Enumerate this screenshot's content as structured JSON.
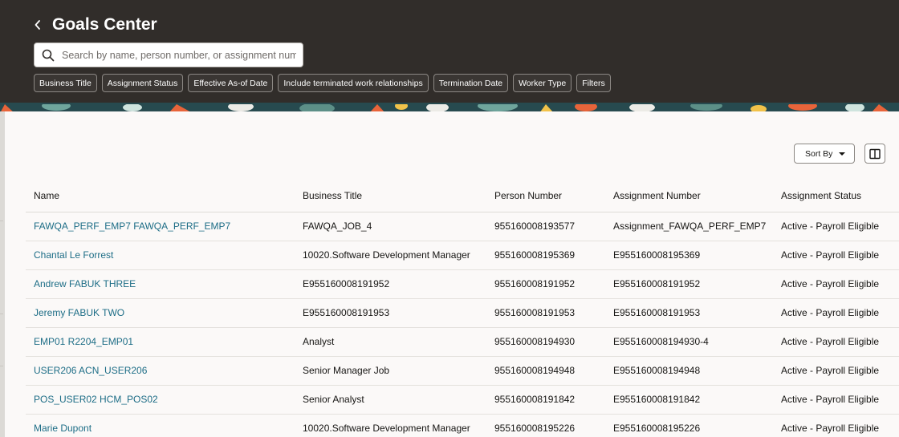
{
  "header": {
    "title": "Goals Center",
    "search": {
      "placeholder": "Search by name, person number, or assignment number",
      "value": ""
    },
    "filter_chips": [
      "Business Title",
      "Assignment Status",
      "Effective As-of Date",
      "Include terminated work relationships",
      "Termination Date",
      "Worker Type",
      "Filters"
    ]
  },
  "toolbar": {
    "sort_label": "Sort By"
  },
  "table": {
    "columns": [
      "Name",
      "Business Title",
      "Person Number",
      "Assignment Number",
      "Assignment Status"
    ],
    "rows": [
      [
        "FAWQA_PERF_EMP7 FAWQA_PERF_EMP7",
        "FAWQA_JOB_4",
        "955160008193577",
        "Assignment_FAWQA_PERF_EMP7",
        "Active - Payroll Eligible"
      ],
      [
        "Chantal Le Forrest",
        "10020.Software Development Manager",
        "955160008195369",
        "E955160008195369",
        "Active - Payroll Eligible"
      ],
      [
        "Andrew FABUK THREE",
        "E955160008191952",
        "955160008191952",
        "E955160008191952",
        "Active - Payroll Eligible"
      ],
      [
        "Jeremy FABUK TWO",
        "E955160008191953",
        "955160008191953",
        "E955160008191953",
        "Active - Payroll Eligible"
      ],
      [
        "EMP01 R2204_EMP01",
        "Analyst",
        "955160008194930",
        "E955160008194930-4",
        "Active - Payroll Eligible"
      ],
      [
        "USER206 ACN_USER206",
        "Senior Manager Job",
        "955160008194948",
        "E955160008194948",
        "Active - Payroll Eligible"
      ],
      [
        "POS_USER02 HCM_POS02",
        "Senior Analyst",
        "955160008191842",
        "E955160008191842",
        "Active - Payroll Eligible"
      ],
      [
        "Marie Dupont",
        "10020.Software Development Manager",
        "955160008195226",
        "E955160008195226",
        "Active - Payroll Eligible"
      ]
    ]
  },
  "colors": {
    "header_bg": "#312d2a",
    "link": "#1d6d86",
    "page_bg": "#fbf9f8"
  },
  "icons": {
    "back": "chevron-left-icon",
    "search": "search-icon",
    "columns": "columns-icon",
    "sort": "caret-down-icon"
  }
}
